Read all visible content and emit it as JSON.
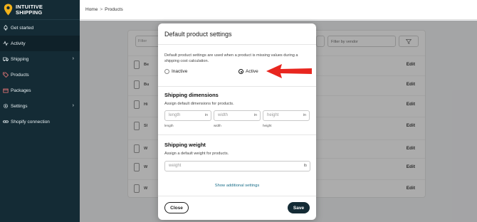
{
  "brand": {
    "line1": "INTUITIVE",
    "line2": "SHIPPING"
  },
  "sidebar": {
    "items": [
      {
        "label": "Get started",
        "icon": "rocket-icon"
      },
      {
        "label": "Activity",
        "icon": "activity-icon"
      },
      {
        "label": "Shipping",
        "icon": "truck-icon"
      },
      {
        "label": "Products",
        "icon": "tag-icon"
      },
      {
        "label": "Packages",
        "icon": "box-icon"
      },
      {
        "label": "Settings",
        "icon": "gear-icon"
      },
      {
        "label": "Shopify connection",
        "icon": "link-icon"
      }
    ]
  },
  "breadcrumb": {
    "home": "Home",
    "separator": ">",
    "current": "Products"
  },
  "background": {
    "search_placeholder": "Filter",
    "vendor_placeholder": "Filter by vendor",
    "rows": [
      {
        "name": "Be",
        "edit": "Edit"
      },
      {
        "name": "Bu",
        "edit": "Edit"
      },
      {
        "name": "Hi",
        "edit": "Edit"
      },
      {
        "name": "Sl",
        "edit": "Edit"
      },
      {
        "name": "W",
        "edit": "Edit"
      },
      {
        "name": "W",
        "edit": "Edit"
      },
      {
        "name": "W",
        "edit": "Edit"
      }
    ]
  },
  "modal": {
    "title": "Default product settings",
    "description": "Default product settings are used when a product is missing values during a shipping cost calculation.",
    "status_options": [
      {
        "label": "Inactive",
        "checked": false
      },
      {
        "label": "Active",
        "checked": true
      }
    ],
    "dimensions": {
      "title": "Shipping dimensions",
      "subtitle": "Assign default dimensions for products.",
      "fields": [
        {
          "placeholder": "length",
          "unit": "in",
          "label": "length"
        },
        {
          "placeholder": "width",
          "unit": "in",
          "label": "width"
        },
        {
          "placeholder": "height",
          "unit": "in",
          "label": "height"
        }
      ]
    },
    "weight": {
      "title": "Shipping weight",
      "subtitle": "Assign a default weight for products.",
      "placeholder": "weight",
      "unit": "lb"
    },
    "show_more": "Show additional settings",
    "close_label": "Close",
    "save_label": "Save"
  },
  "colors": {
    "sidebar": "#142b35",
    "accent_arrow": "#e8261f",
    "link": "#1b6f8a"
  }
}
